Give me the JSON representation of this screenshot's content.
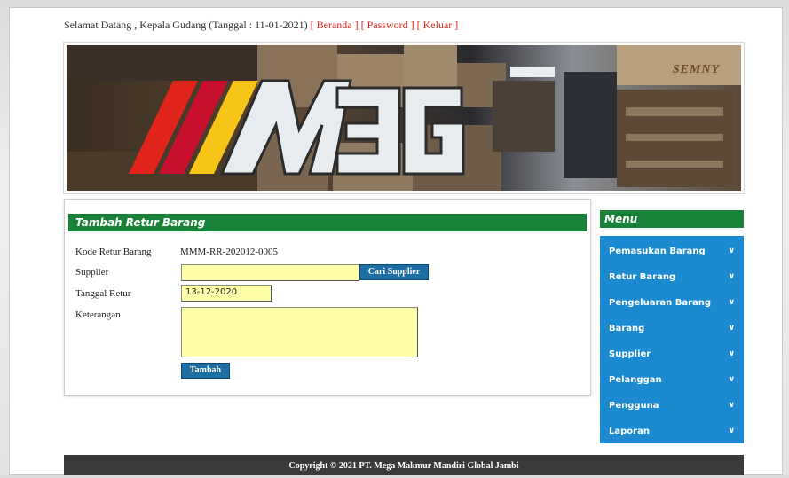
{
  "header": {
    "welcome_text": "Selamat Datang , Kepala Gudang (Tanggal : 11-01-2021)",
    "links": [
      "[ Beranda ]",
      "[ Password ]",
      "[ Keluar ]"
    ]
  },
  "banner": {
    "logo_text": "M3G",
    "sign_text": "SEMNY"
  },
  "form": {
    "title": "Tambah Retur Barang",
    "kode_label": "Kode Retur Barang",
    "kode_value": "MMM-RR-202012-0005",
    "supplier_label": "Supplier",
    "supplier_value": "",
    "cari_supplier_button": "Cari Supplier",
    "tanggal_label": "Tanggal Retur",
    "tanggal_value": "13-12-2020",
    "keterangan_label": "Keterangan",
    "keterangan_value": "",
    "submit_button": "Tambah"
  },
  "menu": {
    "title": "Menu",
    "items": [
      "Pemasukan Barang",
      "Retur Barang",
      "Pengeluaran Barang",
      "Barang",
      "Supplier",
      "Pelanggan",
      "Pengguna",
      "Laporan"
    ]
  },
  "footer": {
    "text": "Copyright © 2021 PT. Mega Makmur Mandiri Global Jambi"
  },
  "colors": {
    "green_header": "#1a8238",
    "menu_blue": "#1c8ad0",
    "button_blue": "#1c6ea3",
    "input_yellow": "#ffffa8",
    "link_red": "#e0241b"
  }
}
